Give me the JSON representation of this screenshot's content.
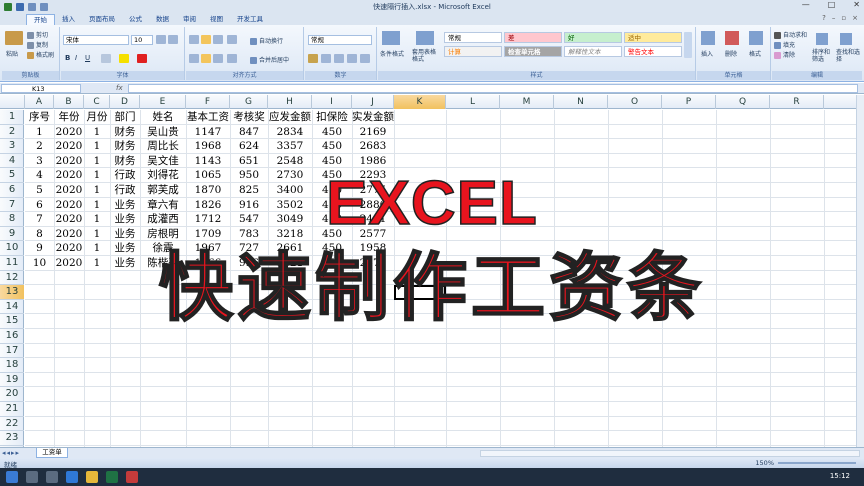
{
  "window": {
    "title": "快速隔行插入.xlsx - Microsoft Excel",
    "controls": [
      "—",
      "□",
      "✕"
    ]
  },
  "tabs": [
    "开始",
    "插入",
    "页面布局",
    "公式",
    "数据",
    "审阅",
    "视图",
    "开发工具"
  ],
  "ribbon": {
    "clipboard": {
      "paste": "粘贴",
      "cut": "剪切",
      "copy": "复制",
      "painter": "格式刷",
      "label": "剪贴板"
    },
    "font": {
      "name": "宋体",
      "size": "10",
      "label": "字体"
    },
    "alignment": {
      "wrap": "自动换行",
      "merge": "合并后居中",
      "label": "对齐方式"
    },
    "number": {
      "format": "常规",
      "label": "数字"
    },
    "styles": {
      "conditional": "条件格式",
      "table": "套用表格格式",
      "cells": [
        "常规",
        "差",
        "好",
        "适中",
        "计算",
        "检查单元格",
        "解释性文本",
        "警告文本"
      ],
      "label": "样式"
    },
    "cells_group": {
      "insert": "插入",
      "delete": "删除",
      "format": "格式",
      "label": "单元格"
    },
    "editing": {
      "autosum": "自动求和",
      "fill": "填充",
      "clear": "清除",
      "sort": "排序和筛选",
      "find": "查找和选择",
      "label": "编辑"
    }
  },
  "formula_bar": {
    "name_box": "K13",
    "fx": "fx",
    "value": ""
  },
  "columns": [
    "A",
    "B",
    "C",
    "D",
    "E",
    "F",
    "G",
    "H",
    "I",
    "J",
    "K",
    "L",
    "M",
    "N",
    "O",
    "P",
    "Q",
    "R"
  ],
  "rows": [
    "1",
    "2",
    "3",
    "4",
    "5",
    "6",
    "7",
    "8",
    "9",
    "10",
    "11",
    "12",
    "13",
    "14",
    "15",
    "16",
    "17",
    "18",
    "19",
    "20",
    "21",
    "22",
    "23",
    "24"
  ],
  "table": {
    "headers": [
      "序号",
      "年份",
      "月份",
      "部门",
      "姓名",
      "基本工资",
      "考核奖",
      "应发金额",
      "扣保险",
      "实发金额"
    ],
    "rows": [
      [
        "1",
        "2020",
        "1",
        "财务",
        "吴山贵",
        "1147",
        "847",
        "2834",
        "450",
        "2169"
      ],
      [
        "2",
        "2020",
        "1",
        "财务",
        "周比长",
        "1968",
        "624",
        "3357",
        "450",
        "2683"
      ],
      [
        "3",
        "2020",
        "1",
        "财务",
        "吴文佳",
        "1143",
        "651",
        "2548",
        "450",
        "1986"
      ],
      [
        "4",
        "2020",
        "1",
        "行政",
        "刘得花",
        "1065",
        "950",
        "2730",
        "450",
        "2293"
      ],
      [
        "5",
        "2020",
        "1",
        "行政",
        "郭芙成",
        "1870",
        "825",
        "3400",
        "450",
        "2775"
      ],
      [
        "6",
        "2020",
        "1",
        "业务",
        "章六有",
        "1826",
        "916",
        "3502",
        "450",
        "2886"
      ],
      [
        "7",
        "2020",
        "1",
        "业务",
        "成灌西",
        "1712",
        "547",
        "3049",
        "450",
        "2461"
      ],
      [
        "8",
        "2020",
        "1",
        "业务",
        "房根明",
        "1709",
        "783",
        "3218",
        "450",
        "2577"
      ],
      [
        "9",
        "2020",
        "1",
        "业务",
        "徐震",
        "1967",
        "727",
        "2661",
        "450",
        "1958"
      ],
      [
        "10",
        "2020",
        "1",
        "业务",
        "陈楷哥",
        "1966",
        "996",
        "3121",
        "450",
        "2473"
      ]
    ]
  },
  "overlay": {
    "line1": "EXCEL",
    "line2": "快速制作工资条"
  },
  "sheet_tab": "工资单",
  "status": {
    "ready": "就绪",
    "zoom": "150%"
  },
  "taskbar": {
    "clock": "15:12"
  },
  "colors": {
    "overlay_red": "#e8141e",
    "selected_header": "#f1c15f",
    "ribbon_blue": "#dbe5f1"
  }
}
